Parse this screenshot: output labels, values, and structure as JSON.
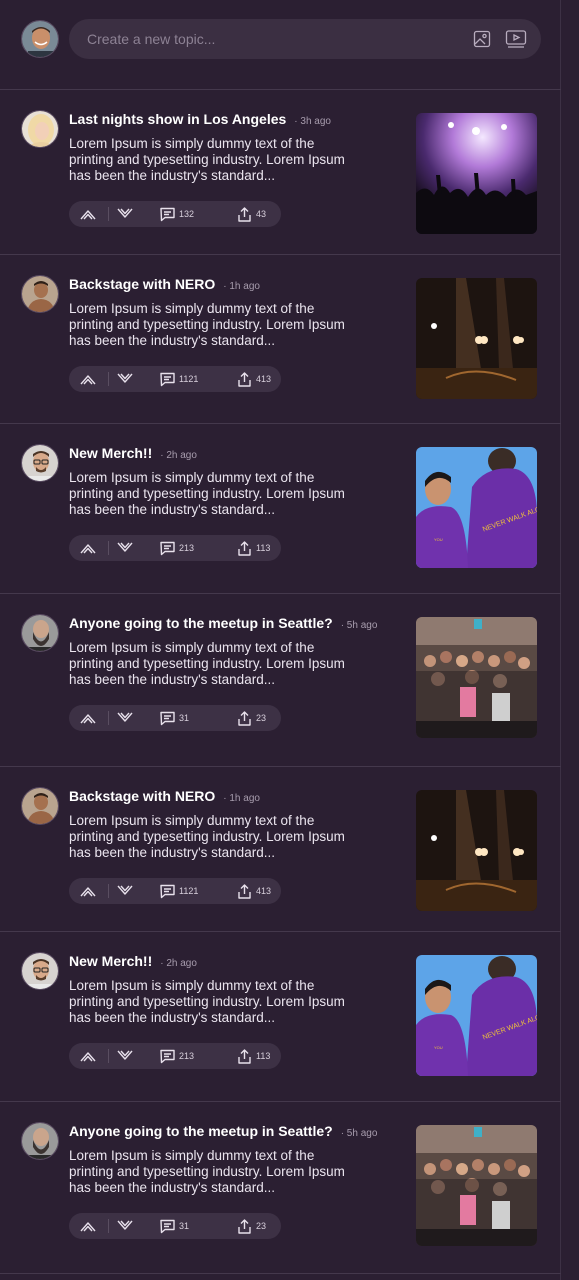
{
  "composer": {
    "placeholder": "Create a new topic...",
    "image_icon": "image-icon",
    "video_icon": "video-icon"
  },
  "posts": [
    {
      "title": "Last nights show in Los Angeles",
      "time": "3h ago",
      "body": "Lorem Ipsum is simply dummy text of the printing and typesetting industry. Lorem Ipsum has been the industry's standard...",
      "comments": "132",
      "shares": "43",
      "avatar": "blonde-woman",
      "image": "concert-crowd"
    },
    {
      "title": "Backstage with NERO",
      "time": "1h ago",
      "body": "Lorem Ipsum is simply dummy text of the printing and typesetting industry. Lorem Ipsum has been the industry's standard...",
      "comments": "1121",
      "shares": "413",
      "avatar": "shirtless-man",
      "image": "stage-lights"
    },
    {
      "title": "New Merch!!",
      "time": "2h ago",
      "body": "Lorem Ipsum is simply dummy text of the printing and typesetting industry. Lorem Ipsum has been the industry's standard...",
      "comments": "213",
      "shares": "113",
      "avatar": "glasses-man",
      "image": "purple-hoodies"
    },
    {
      "title": "Anyone going to the meetup in Seattle?",
      "time": "5h ago",
      "body": "Lorem Ipsum is simply dummy text of the printing and typesetting industry. Lorem Ipsum has been the industry's standard...",
      "comments": "31",
      "shares": "23",
      "avatar": "bearded-man",
      "image": "group-photo"
    },
    {
      "title": "Backstage with NERO",
      "time": "1h ago",
      "body": "Lorem Ipsum is simply dummy text of the printing and typesetting industry. Lorem Ipsum has been the industry's standard...",
      "comments": "1121",
      "shares": "413",
      "avatar": "shirtless-man",
      "image": "stage-lights"
    },
    {
      "title": "New Merch!!",
      "time": "2h ago",
      "body": "Lorem Ipsum is simply dummy text of the printing and typesetting industry. Lorem Ipsum has been the industry's standard...",
      "comments": "213",
      "shares": "113",
      "avatar": "glasses-man",
      "image": "purple-hoodies"
    },
    {
      "title": "Anyone going to the meetup in Seattle?",
      "time": "5h ago",
      "body": "Lorem Ipsum is simply dummy text of the printing and typesetting industry. Lorem Ipsum has been the industry's standard...",
      "comments": "31",
      "shares": "23",
      "avatar": "bearded-man",
      "image": "group-photo"
    }
  ],
  "colors": {
    "background": "#2b1f32",
    "surface": "#3b2f42",
    "divider": "#44384c",
    "text": "#ffffff",
    "muted": "#a79cad"
  }
}
